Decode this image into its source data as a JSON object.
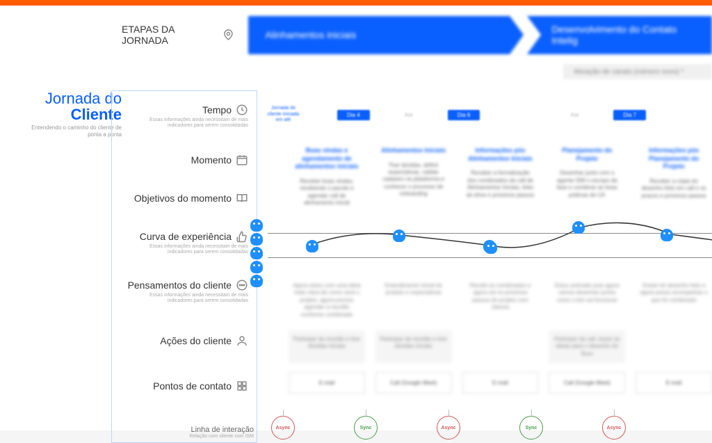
{
  "header": {
    "stages_title": "ETAPAS DA JORNADA",
    "stage1": "Alinhamentos iniciais",
    "stage2": "Desenvolvimento do Contato Intelig",
    "subhead": "Ativação de canais (número novo) *"
  },
  "title": {
    "line1": "Jornada do",
    "line2": "Cliente",
    "sub": "Entendendo o caminho do cliente de ponta a ponta"
  },
  "rows": {
    "tempo": {
      "label": "Tempo",
      "note": "Essas informações ainda necessitam de mais indicadores para serem consolidadas"
    },
    "momento": {
      "label": "Momento"
    },
    "objetivos": {
      "label": "Objetivos do momento"
    },
    "curva": {
      "label": "Curva de experiência",
      "note": "Essas informações ainda necessitam de mais indicadores para serem consolidadas"
    },
    "pensamentos": {
      "label": "Pensamentos do cliente",
      "note": "Essas informações ainda necessitam de mais indicadores para serem consolidadas"
    },
    "acoes": {
      "label": "Ações do cliente"
    },
    "pontos": {
      "label": "Pontos de contato"
    }
  },
  "time": {
    "intro": "Jornada do cliente iniciada em até",
    "chip1": "Dia 4",
    "dash1": "Até",
    "chip2": "Dia 6",
    "dash2": "Até",
    "chip3": "Dia 7"
  },
  "moments": {
    "m1": {
      "head": "Boas vindas e agendamento de alinhamentos iniciais",
      "body": "Receber boas vindas, recebendo o pacote e agendar call de alinhamento inicial"
    },
    "m2": {
      "head": "Alinhamentos Iniciais",
      "body": "Tirar dúvidas, definir expectativas, validar cadastro na plataforma e conhecer o processo de onboarding"
    },
    "m3": {
      "head": "Informações pós Alinhamentos Iniciais",
      "body": "Receber a formalização dos combinados da call de Alinhamentos Iniciais, links de drive e próximos passos"
    },
    "m4": {
      "head": "Planejamento do Projeto",
      "body": "Desenhar junto com o agente ISM o escopo da fase e combinar as boas práticas de UX"
    },
    "m5": {
      "head": "Informações pós Planejamento do Projeto",
      "body": "Receber a cópia do desenho feito em call e os prazos e próximos passos"
    }
  },
  "thoughts": {
    "t1": "Agora estou com uma ideia mais clara de como será o projeto, agora preciso agendar a reunião conforme combinado",
    "t2": "Entendimento inicial do produto e expectativas",
    "t3": "Recebi os combinados e agora sei os próximos passos do projeto com clareza",
    "t4": "Estou animado pois agora vamos desenhar juntos como o bot vai funcionar",
    "t5": "Gostei do desenho feito e agora posso acompanhar o que foi combinado"
  },
  "actions": {
    "a1": "Participar da reunião e tirar dúvidas iniciais",
    "a2": "Participar da reunião e tirar dúvidas iniciais",
    "a3": "",
    "a4": "Participar da call, trazer as ideias para o desenho do fluxo",
    "a5": ""
  },
  "touch": {
    "p1": "E-mail",
    "p2": "Call (Google Meet)",
    "p3": "E-mail",
    "p4": "Call (Google Meet)",
    "p5": "E-mail"
  },
  "interaction": {
    "label": "Linha de interação",
    "sub": "Relação com cliente com ISM",
    "s1": "Async",
    "s2": "Sync",
    "s3": "Async",
    "s4": "Sync",
    "s5": "Async"
  },
  "chart_data": {
    "type": "line",
    "title": "Curva de experiência",
    "y_scale": [
      "muito feliz",
      "feliz",
      "neutro",
      "triste",
      "muito triste"
    ],
    "points": [
      {
        "moment": "Boas vindas",
        "y": "neutro"
      },
      {
        "moment": "Alinhamentos Iniciais",
        "y": "feliz"
      },
      {
        "moment": "Informações pós Alinhamentos",
        "y": "neutro"
      },
      {
        "moment": "Planejamento do Projeto",
        "y": "muito feliz"
      },
      {
        "moment": "Informações pós Planejamento",
        "y": "feliz"
      }
    ]
  }
}
